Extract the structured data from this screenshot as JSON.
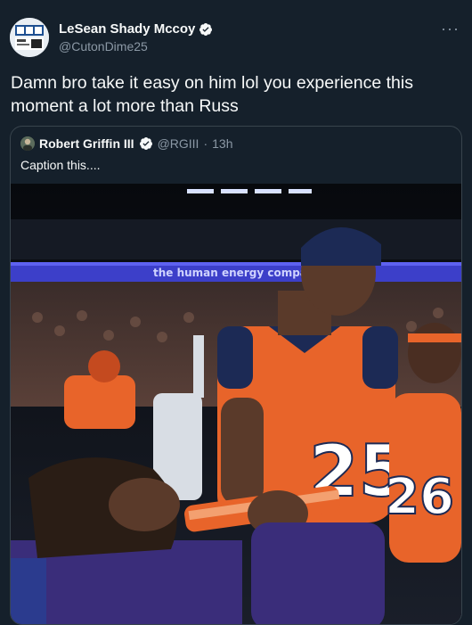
{
  "tweet": {
    "author": {
      "name": "LeSean Shady Mccoy",
      "handle": "@CutonDime25",
      "avatar_icon": "profile-avatar",
      "verified_icon": "verified-badge-icon"
    },
    "more_icon": "more-options-icon",
    "text": "Damn bro take it easy on him lol you experience this moment a lot more than Russ",
    "quoted": {
      "author": {
        "name": "Robert Griffin III",
        "handle": "@RGIII",
        "verified_icon": "verified-badge-icon"
      },
      "separator": "·",
      "time": "13h",
      "text": "Caption this....",
      "photo": {
        "banner_text": "the human energy compan",
        "jersey_numbers": [
          "25",
          "26"
        ]
      }
    }
  },
  "colors": {
    "background": "#15202b",
    "text": "#f7f9f9",
    "muted": "#8b98a5",
    "border": "#38444d",
    "broncos_orange": "#e8642a",
    "broncos_navy": "#1c2a55"
  }
}
